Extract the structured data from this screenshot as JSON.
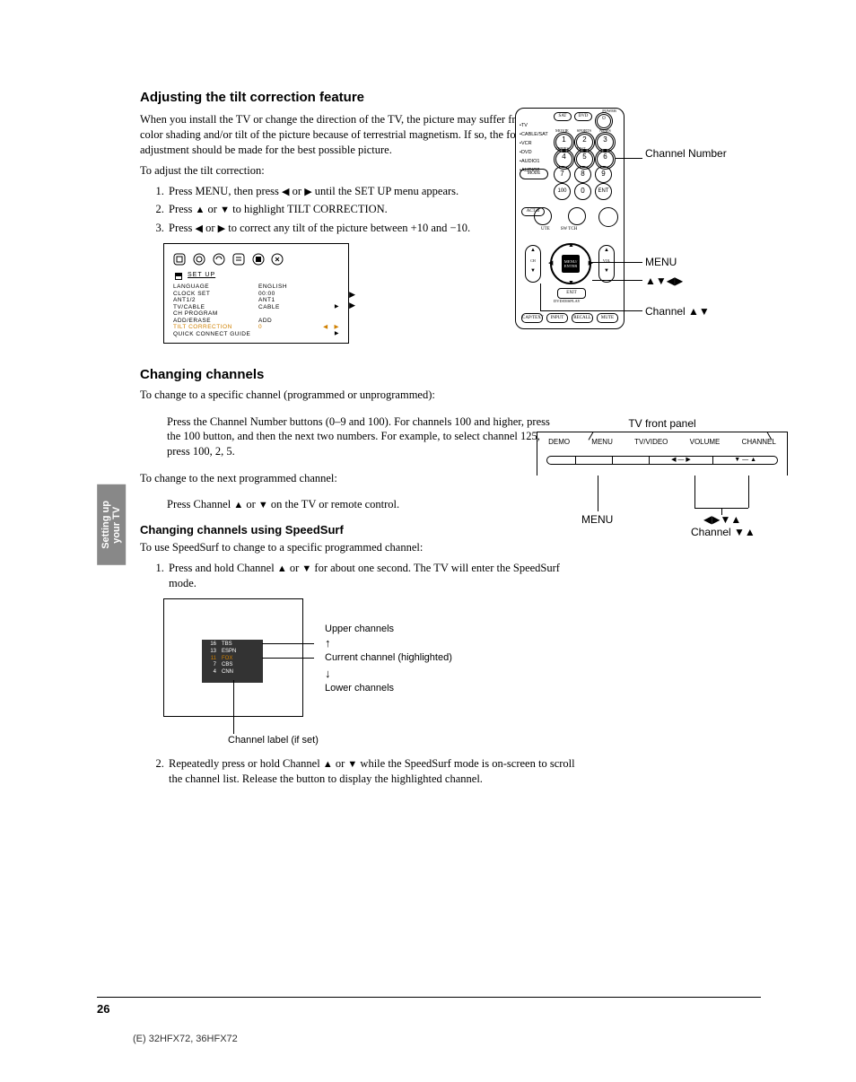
{
  "sideTab": {
    "line1": "Setting up",
    "line2": "your TV"
  },
  "sec1": {
    "heading": "Adjusting the tilt correction feature",
    "p1": "When you install the TV or change the direction of the TV, the picture may suffer from color shading and/or tilt of the picture because of terrestrial magnetism. If so, the following adjustment should be made for the best possible picture.",
    "p2": "To adjust the tilt correction:",
    "step1a": "Press MENU, then press ",
    "step1b": " or ",
    "step1c": " until the SET UP menu appears.",
    "step2a": "Press ",
    "step2b": " or ",
    "step2c": " to highlight TILT CORRECTION.",
    "step3a": "Press ",
    "step3b": " or ",
    "step3c": " to correct any tilt of the picture between +10 and −10."
  },
  "setupMenu": {
    "title": "SET  UP",
    "rows": [
      {
        "lbl": "LANGUAGE",
        "val": "ENGLISH"
      },
      {
        "lbl": "CLOCK  SET",
        "val": "00:00"
      },
      {
        "lbl": "ANT1/2",
        "val": "ANT1"
      },
      {
        "lbl": "TV/CABLE",
        "val": "CABLE"
      },
      {
        "lbl": "CH  PROGRAM",
        "val": ""
      },
      {
        "lbl": "ADD/ERASE",
        "val": "ADD"
      },
      {
        "lbl": "TILT  CORRECTION",
        "val": "0",
        "hl": true
      },
      {
        "lbl": "QUICK  CONNECT  GUIDE",
        "val": ""
      }
    ]
  },
  "sec2": {
    "heading": "Changing channels",
    "p1": "To change to a specific channel (programmed or unprogrammed):",
    "ind1": "Press the Channel Number buttons (0–9 and 100). For channels 100 and higher, press the 100 button, and then the next two numbers. For example, to select channel 125, press 100, 2, 5.",
    "p2": "To change to the next programmed channel:",
    "ind2a": "Press Channel ",
    "ind2b": " or ",
    "ind2c": " on the TV or remote control.",
    "sub": "Changing channels using SpeedSurf",
    "p3": "To use SpeedSurf to change to a specific programmed channel:",
    "step1a": "Press and hold Channel ",
    "step1b": " or ",
    "step1c": " for about one second. The TV will enter the SpeedSurf mode.",
    "step2a": "Repeatedly press or hold Channel ",
    "step2b": " or ",
    "step2c": " while the SpeedSurf mode is on-screen to scroll the channel list. Release the button to display the highlighted channel."
  },
  "speedsurf": {
    "rows": [
      {
        "n": "16",
        "c": "TBS"
      },
      {
        "n": "13",
        "c": "ESPN"
      },
      {
        "n": "11",
        "c": "FOX",
        "hl": true
      },
      {
        "n": "7",
        "c": "CBS"
      },
      {
        "n": "4",
        "c": "CNN"
      }
    ],
    "upper": "Upper channels",
    "current": "Current channel (highlighted)",
    "lower": "Lower channels",
    "label": "Channel label (if set)"
  },
  "remote": {
    "topOvals": [
      "SAT",
      "DVD"
    ],
    "power": "POWER",
    "sideLabels": [
      "TV",
      "CABLE/SAT",
      "VCR",
      "DVD",
      "AUDIO1",
      "AUDIO2"
    ],
    "mode": "MODE",
    "rowLabels": [
      "MOVIE",
      "SPORTS",
      "NEWS",
      "SERIES",
      "LIST"
    ],
    "nums": [
      "1",
      "2",
      "3",
      "4",
      "5",
      "6",
      "7",
      "8",
      "9",
      "100",
      "0",
      "ENT"
    ],
    "roundLbls": [
      "FAVⓐ",
      "FAV CH/•"
    ],
    "dpadCenter": "MENU/\nENTER",
    "exit": "EXIT",
    "bottom": [
      "CAP/TEXT",
      "INPUT",
      "RECALL",
      "MUTE"
    ],
    "callout1": "Channel Number",
    "callout2": "MENU",
    "callout3": "▲▼◀▶",
    "callout4": "Channel ▲▼"
  },
  "tvpanel": {
    "title": "TV front panel",
    "cols": [
      "DEMO",
      "MENU",
      "TV/VIDEO",
      "VOLUME",
      "CHANNEL"
    ],
    "barSegs": [
      "",
      "",
      "",
      "◀ — ▶",
      "▼ — ▲"
    ],
    "lbl1": "MENU",
    "lbl2a": "◀▶▼▲",
    "lbl2b": "Channel ▼▲"
  },
  "glyphs": {
    "left": "◀",
    "right": "▶",
    "up": "▲",
    "down": "▼",
    "upArrow": "↑",
    "downArrow": "↓"
  },
  "footer": {
    "page": "26",
    "model": "(E) 32HFX72, 36HFX72"
  }
}
